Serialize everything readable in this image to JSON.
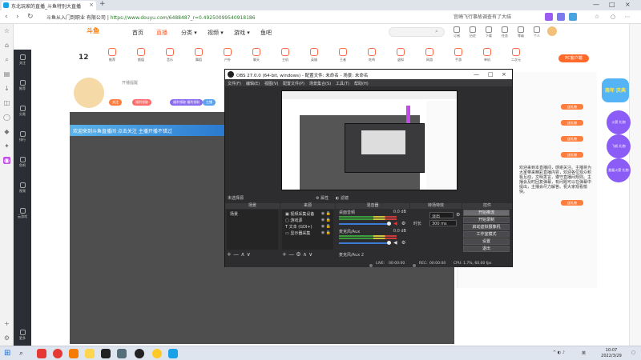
{
  "browser": {
    "tab_title": "东北玩家的直播_斗鱼特别大直播",
    "new_tab": "+",
    "url_host": "斗鱼 直播",
    "url_path": "https://www.douyu.com/6488487_r=0.4925009954091818​6",
    "url_prefix": "斗鱼从入门到职业 有限公司 |",
    "search_text": "宫崎飞行事故调查有了大结",
    "win_min": "—",
    "win_max": "□",
    "win_close": "×",
    "back": "‹",
    "forward": "›",
    "refresh": "↻",
    "home": "⌂"
  },
  "douyu": {
    "logo": "斗鱼",
    "nav": [
      "首页",
      "直播",
      "分类 ▾",
      "视频 ▾",
      "游戏 ▾",
      "鱼吧"
    ],
    "search_placeholder": "",
    "top_icons": [
      "订阅",
      "历史",
      "下载",
      "任务",
      "等级",
      "个人"
    ],
    "follow_count": "12",
    "categories": [
      "关注",
      "推荐",
      "颜值",
      "音乐",
      "舞蹈",
      "户外",
      "聊天",
      "主机",
      "英雄",
      "王者",
      "吃鸡",
      "虚拟",
      "网游",
      "手游",
      "单机",
      "二次元",
      "科技",
      "体育",
      "其他"
    ],
    "streamer_label": "开播提醒",
    "tags": [
      {
        "text": "关注",
        "color": "#ff7e3e"
      },
      {
        "text": "福利领取",
        "color": "#ff6d6d"
      },
      {
        "text": "福利领取 福利领取",
        "color": "#8b6cf0"
      },
      {
        "text": "福利领取 福利领取",
        "color": "#6c8cf0"
      },
      {
        "text": "主播",
        "color": "#5aa2f0"
      }
    ],
    "banner": "欢迎来到斗鱼直播间 点击关注 主播开播不错过",
    "pc_button": "PC客户端",
    "gift_head": "周年 庆典",
    "chat_lines": [
      "贡献榜",
      "粉丝榜",
      "主播 排行",
      "贵宾 席位",
      "斗鱼 直播 欢迎",
      "送出 礼物 x1",
      "主播 加油",
      "欢迎 进入直播间",
      "大家好"
    ],
    "badges": [
      "送礼物",
      "送礼物",
      "送礼物",
      "送礼物",
      "送礼物"
    ],
    "gifts": [
      "火箭 礼物",
      "飞机 礼物",
      "超级火箭 礼物"
    ],
    "article": "欢迎来到本直播间，感谢关注。主播将为大家带来精彩直播内容，欢迎各位观众积极互动，文明发言，遵守直播间规则。主播会及时回复弹幕，有问题可以在弹幕中提出，主播会尽力解答。祝大家观看愉快。",
    "left_menu": [
      "关注",
      "推荐",
      "分类",
      "排行",
      "鱼吧",
      "视频",
      "云游戏",
      "更多"
    ]
  },
  "obs": {
    "title": "OBS 27.0.0 (64-bit, windows) - 配置文件: 未命名 - 场景: 未命名",
    "menu": [
      "文件(F)",
      "编辑(E)",
      "视图(V)",
      "配置文件(P)",
      "场景集合(S)",
      "工具(T)",
      "帮助(H)"
    ],
    "scene_bar_label": "未选择源",
    "props_button": "属性",
    "filters_button": "滤镜",
    "docks": {
      "scenes": "场景",
      "sources": "来源",
      "mixer": "混音器",
      "transitions": "转场特效",
      "controls": "控件"
    },
    "scene_items": [
      "场景"
    ],
    "sources": [
      "视频采集设备",
      "游戏源",
      "文本 (GDI+)",
      "显示器采集"
    ],
    "mixer_channels": [
      {
        "name": "桌面音频",
        "db": "0.0 dB",
        "level": 0.7
      },
      {
        "name": "麦克风/Aux",
        "db": "0.0 dB",
        "level": 0.6
      },
      {
        "name": "麦克风/Aux 2",
        "db": "0.0 dB",
        "level": 0.55
      }
    ],
    "transition": {
      "type": "淡出",
      "duration_label": "时长",
      "duration": "300 ms"
    },
    "controls": [
      "开始推流",
      "开始录制",
      "启动虚拟摄像机",
      "工作室模式",
      "设置",
      "退出"
    ],
    "status": {
      "live_label": "LIVE:",
      "live_time": "00:00:00",
      "rec_label": "REC:",
      "rec_time": "00:00:00",
      "cpu": "CPU: 1.7%, 60.00 fps"
    },
    "tool_buttons": "+ — ∧ ∨",
    "src_tool_buttons": "+ — ⚙ ∧ ∨"
  },
  "taskbar": {
    "clock_time": "10:07",
    "clock_date": "2022/3/29",
    "tray_text": "英"
  }
}
